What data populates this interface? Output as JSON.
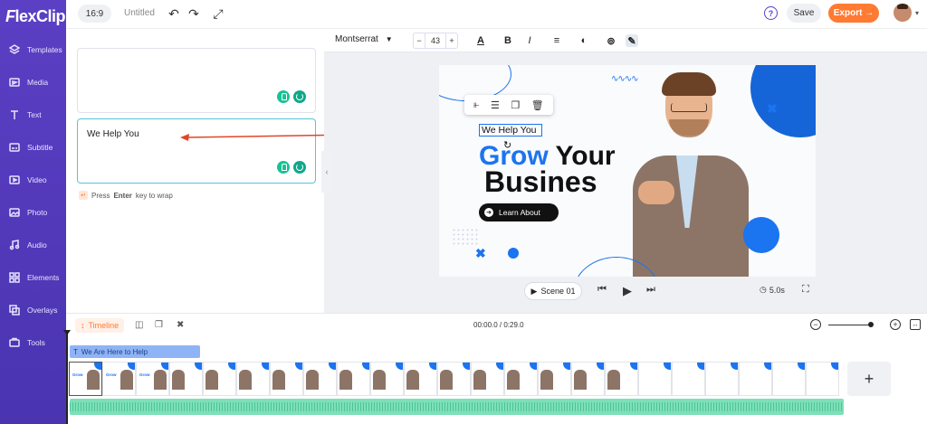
{
  "app": {
    "logo_prefix": "F",
    "logo_text": "lexClip"
  },
  "sidebar": {
    "items": [
      {
        "label": "Templates",
        "icon": "layers-icon"
      },
      {
        "label": "Media",
        "icon": "media-icon"
      },
      {
        "label": "Text",
        "icon": "text-icon"
      },
      {
        "label": "Subtitle",
        "icon": "subtitle-icon"
      },
      {
        "label": "Video",
        "icon": "video-icon"
      },
      {
        "label": "Photo",
        "icon": "photo-icon"
      },
      {
        "label": "Audio",
        "icon": "audio-icon"
      },
      {
        "label": "Elements",
        "icon": "elements-icon"
      },
      {
        "label": "Overlays",
        "icon": "overlays-icon"
      },
      {
        "label": "Tools",
        "icon": "tools-icon"
      }
    ]
  },
  "header": {
    "ratio": "16:9",
    "title": "Untitled",
    "save_label": "Save",
    "export_label": "Export →",
    "help": "?"
  },
  "text_panel": {
    "card1_text": "",
    "card2_text": "We Help You",
    "hint_prefix": "Press ",
    "hint_key": "Enter",
    "hint_suffix": " key to wrap"
  },
  "format_toolbar": {
    "font": "Montserrat",
    "font_size": "43"
  },
  "preview": {
    "selected_text": "We Help You",
    "headline_blue": "Grow",
    "headline_rest": " Your",
    "headline_line2": "Busines",
    "cta": "Learn About",
    "scene_label": "Scene 01",
    "duration": "5.0s"
  },
  "timeline": {
    "label": "Timeline",
    "time": "00:00.0 / 0:29.0",
    "text_track": "We  Are  Here  to  Help"
  },
  "colors": {
    "sidebar": "#5b3fc4",
    "accent": "#ff7a33",
    "brand_blue": "#1b74f0",
    "audio": "#7ee0b8"
  }
}
